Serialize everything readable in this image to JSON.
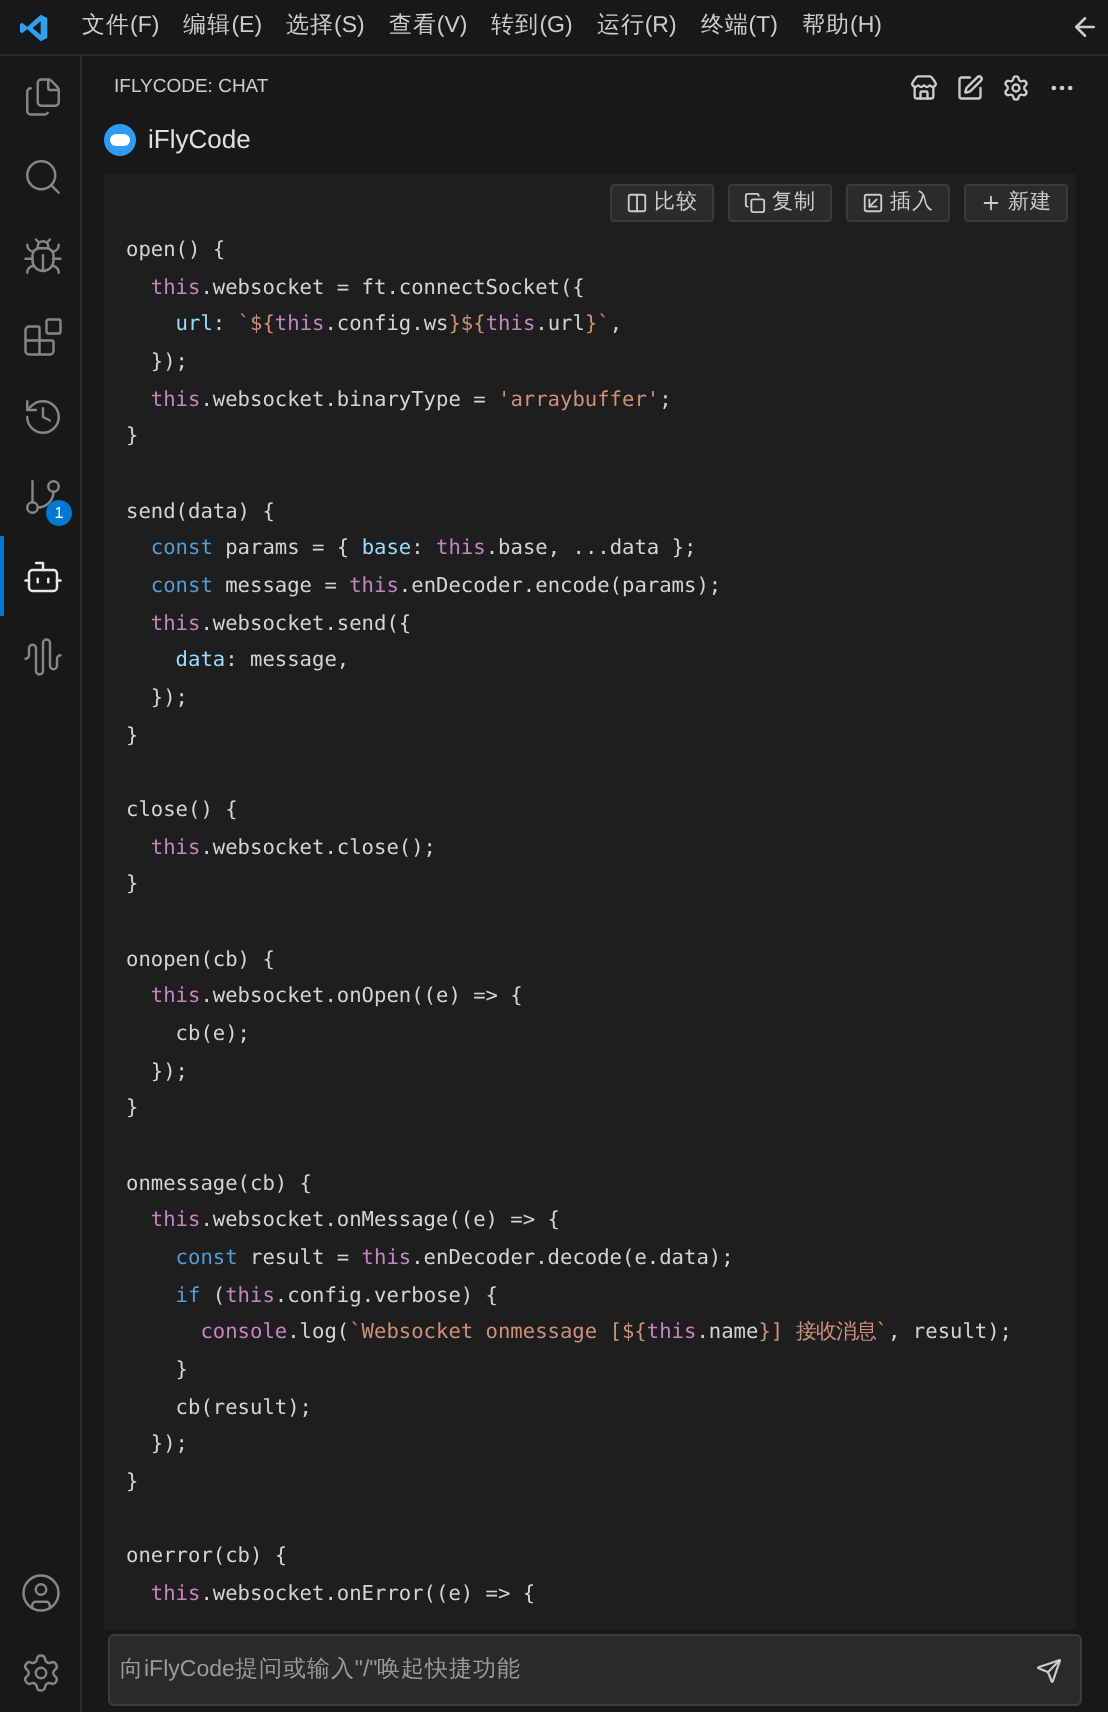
{
  "menu": [
    "文件(F)",
    "编辑(E)",
    "选择(S)",
    "查看(V)",
    "转到(G)",
    "运行(R)",
    "终端(T)",
    "帮助(H)"
  ],
  "activity_bar": [
    {
      "kind": "files",
      "selected": false
    },
    {
      "kind": "search",
      "selected": false
    },
    {
      "kind": "debug",
      "selected": false
    },
    {
      "kind": "extensions",
      "selected": false
    },
    {
      "kind": "timeline",
      "selected": false
    },
    {
      "kind": "git",
      "selected": false,
      "badge": "1"
    },
    {
      "kind": "bot",
      "selected": true
    },
    {
      "kind": "wave",
      "selected": false
    }
  ],
  "panel": {
    "title": "IFLYCODE: CHAT",
    "assistant": "iFlyCode"
  },
  "code_actions": [
    {
      "kind": "compare",
      "label": "比较"
    },
    {
      "kind": "copy",
      "label": "复制"
    },
    {
      "kind": "insert",
      "label": "插入"
    },
    {
      "kind": "new",
      "label": "新建"
    }
  ],
  "code": [
    {
      "kind": "code",
      "tokens": [
        {
          "kind": "plain",
          "text": "open() {"
        }
      ]
    },
    {
      "kind": "code",
      "tokens": [
        {
          "kind": "this",
          "text": "  this"
        },
        {
          "kind": "plain",
          "text": ".websocket = ft.connectSocket({"
        }
      ]
    },
    {
      "kind": "code",
      "tokens": [
        {
          "kind": "property",
          "text": "    url"
        },
        {
          "kind": "plain",
          "text": ": "
        },
        {
          "kind": "string",
          "text": "`${"
        },
        {
          "kind": "this",
          "text": "this"
        },
        {
          "kind": "plain",
          "text": ".config.ws"
        },
        {
          "kind": "string",
          "text": "}${"
        },
        {
          "kind": "this",
          "text": "this"
        },
        {
          "kind": "plain",
          "text": ".url"
        },
        {
          "kind": "string",
          "text": "}`"
        },
        {
          "kind": "plain",
          "text": ","
        }
      ]
    },
    {
      "kind": "code",
      "tokens": [
        {
          "kind": "plain",
          "text": "  });"
        }
      ]
    },
    {
      "kind": "code",
      "tokens": [
        {
          "kind": "this",
          "text": "  this"
        },
        {
          "kind": "plain",
          "text": ".websocket.binaryType = "
        },
        {
          "kind": "string",
          "text": "'arraybuffer'"
        },
        {
          "kind": "plain",
          "text": ";"
        }
      ]
    },
    {
      "kind": "code",
      "tokens": [
        {
          "kind": "plain",
          "text": "}"
        }
      ]
    },
    {
      "kind": "blank"
    },
    {
      "kind": "code",
      "tokens": [
        {
          "kind": "plain",
          "text": "send(data) {"
        }
      ]
    },
    {
      "kind": "code",
      "tokens": [
        {
          "kind": "keyword",
          "text": "  const"
        },
        {
          "kind": "plain",
          "text": " params = { "
        },
        {
          "kind": "property",
          "text": "base"
        },
        {
          "kind": "plain",
          "text": ": "
        },
        {
          "kind": "this",
          "text": "this"
        },
        {
          "kind": "plain",
          "text": ".base, ...data };"
        }
      ]
    },
    {
      "kind": "code",
      "tokens": [
        {
          "kind": "keyword",
          "text": "  const"
        },
        {
          "kind": "plain",
          "text": " message = "
        },
        {
          "kind": "this",
          "text": "this"
        },
        {
          "kind": "plain",
          "text": ".enDecoder.encode(params);"
        }
      ]
    },
    {
      "kind": "code",
      "tokens": [
        {
          "kind": "this",
          "text": "  this"
        },
        {
          "kind": "plain",
          "text": ".websocket.send({"
        }
      ]
    },
    {
      "kind": "code",
      "tokens": [
        {
          "kind": "property",
          "text": "    data"
        },
        {
          "kind": "plain",
          "text": ": message,"
        }
      ]
    },
    {
      "kind": "code",
      "tokens": [
        {
          "kind": "plain",
          "text": "  });"
        }
      ]
    },
    {
      "kind": "code",
      "tokens": [
        {
          "kind": "plain",
          "text": "}"
        }
      ]
    },
    {
      "kind": "blank"
    },
    {
      "kind": "code",
      "tokens": [
        {
          "kind": "plain",
          "text": "close() {"
        }
      ]
    },
    {
      "kind": "code",
      "tokens": [
        {
          "kind": "this",
          "text": "  this"
        },
        {
          "kind": "plain",
          "text": ".websocket.close();"
        }
      ]
    },
    {
      "kind": "code",
      "tokens": [
        {
          "kind": "plain",
          "text": "}"
        }
      ]
    },
    {
      "kind": "blank"
    },
    {
      "kind": "code",
      "tokens": [
        {
          "kind": "plain",
          "text": "onopen(cb) {"
        }
      ]
    },
    {
      "kind": "code",
      "tokens": [
        {
          "kind": "this",
          "text": "  this"
        },
        {
          "kind": "plain",
          "text": ".websocket.onOpen((e) => {"
        }
      ]
    },
    {
      "kind": "code",
      "tokens": [
        {
          "kind": "plain",
          "text": "    cb(e);"
        }
      ]
    },
    {
      "kind": "code",
      "tokens": [
        {
          "kind": "plain",
          "text": "  });"
        }
      ]
    },
    {
      "kind": "code",
      "tokens": [
        {
          "kind": "plain",
          "text": "}"
        }
      ]
    },
    {
      "kind": "blank"
    },
    {
      "kind": "code",
      "tokens": [
        {
          "kind": "plain",
          "text": "onmessage(cb) {"
        }
      ]
    },
    {
      "kind": "code",
      "tokens": [
        {
          "kind": "this",
          "text": "  this"
        },
        {
          "kind": "plain",
          "text": ".websocket.onMessage((e) => {"
        }
      ]
    },
    {
      "kind": "code",
      "tokens": [
        {
          "kind": "keyword",
          "text": "    const"
        },
        {
          "kind": "plain",
          "text": " result = "
        },
        {
          "kind": "this",
          "text": "this"
        },
        {
          "kind": "plain",
          "text": ".enDecoder.decode(e.data);"
        }
      ]
    },
    {
      "kind": "code",
      "tokens": [
        {
          "kind": "keyword",
          "text": "    if"
        },
        {
          "kind": "plain",
          "text": " ("
        },
        {
          "kind": "this",
          "text": "this"
        },
        {
          "kind": "plain",
          "text": ".config.verbose) {"
        }
      ]
    },
    {
      "kind": "code",
      "tokens": [
        {
          "kind": "this",
          "text": "      console"
        },
        {
          "kind": "plain",
          "text": ".log("
        },
        {
          "kind": "string",
          "text": "`Websocket onmessage [${"
        },
        {
          "kind": "this",
          "text": "this"
        },
        {
          "kind": "plain",
          "text": ".name"
        },
        {
          "kind": "string",
          "text": "}] 接收消息`"
        },
        {
          "kind": "plain",
          "text": ", result);"
        }
      ]
    },
    {
      "kind": "code",
      "tokens": [
        {
          "kind": "plain",
          "text": "    }"
        }
      ]
    },
    {
      "kind": "code",
      "tokens": [
        {
          "kind": "plain",
          "text": "    cb(result);"
        }
      ]
    },
    {
      "kind": "code",
      "tokens": [
        {
          "kind": "plain",
          "text": "  });"
        }
      ]
    },
    {
      "kind": "code",
      "tokens": [
        {
          "kind": "plain",
          "text": "}"
        }
      ]
    },
    {
      "kind": "blank"
    },
    {
      "kind": "code",
      "tokens": [
        {
          "kind": "plain",
          "text": "onerror(cb) {"
        }
      ]
    },
    {
      "kind": "code",
      "tokens": [
        {
          "kind": "this",
          "text": "  this"
        },
        {
          "kind": "plain",
          "text": ".websocket.onError((e) => {"
        }
      ]
    }
  ],
  "input": {
    "placeholder": "向iFlyCode提问或输入\"/\"唤起快捷功能"
  }
}
